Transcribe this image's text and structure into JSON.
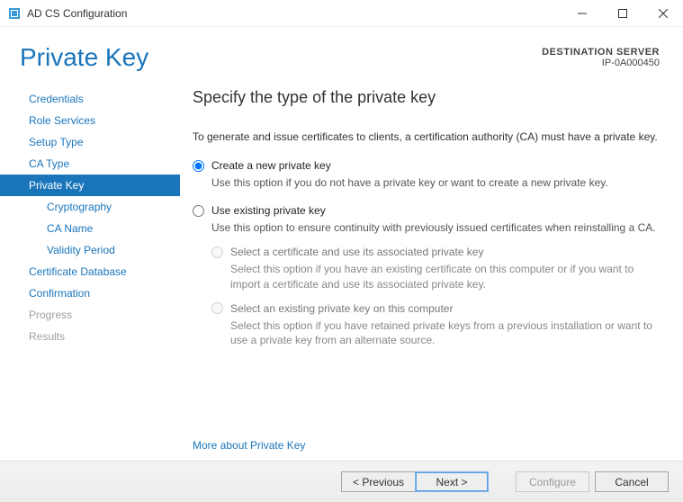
{
  "window": {
    "title": "AD CS Configuration"
  },
  "header": {
    "page_title": "Private Key",
    "destination_label": "DESTINATION SERVER",
    "destination_value": "IP-0A000450"
  },
  "sidebar": {
    "steps": [
      {
        "label": "Credentials",
        "selected": false,
        "child": false,
        "disabled": false
      },
      {
        "label": "Role Services",
        "selected": false,
        "child": false,
        "disabled": false
      },
      {
        "label": "Setup Type",
        "selected": false,
        "child": false,
        "disabled": false
      },
      {
        "label": "CA Type",
        "selected": false,
        "child": false,
        "disabled": false
      },
      {
        "label": "Private Key",
        "selected": true,
        "child": false,
        "disabled": false
      },
      {
        "label": "Cryptography",
        "selected": false,
        "child": true,
        "disabled": false
      },
      {
        "label": "CA Name",
        "selected": false,
        "child": true,
        "disabled": false
      },
      {
        "label": "Validity Period",
        "selected": false,
        "child": true,
        "disabled": false
      },
      {
        "label": "Certificate Database",
        "selected": false,
        "child": false,
        "disabled": false
      },
      {
        "label": "Confirmation",
        "selected": false,
        "child": false,
        "disabled": false
      },
      {
        "label": "Progress",
        "selected": false,
        "child": false,
        "disabled": true
      },
      {
        "label": "Results",
        "selected": false,
        "child": false,
        "disabled": true
      }
    ]
  },
  "main": {
    "heading": "Specify the type of the private key",
    "intro": "To generate and issue certificates to clients, a certification authority (CA) must have a private key.",
    "options": {
      "create": {
        "label": "Create a new private key",
        "desc": "Use this option if you do not have a private key or want to create a new private key.",
        "checked": true
      },
      "existing": {
        "label": "Use existing private key",
        "desc": "Use this option to ensure continuity with previously issued certificates when reinstalling a CA.",
        "checked": false,
        "sub": {
          "select_cert": {
            "label": "Select a certificate and use its associated private key",
            "desc": "Select this option if you have an existing certificate on this computer or if you want to import a certificate and use its associated private key."
          },
          "select_key": {
            "label": "Select an existing private key on this computer",
            "desc": "Select this option if you have retained private keys from a previous installation or want to use a private key from an alternate source."
          }
        }
      }
    },
    "more_link": "More about Private Key"
  },
  "footer": {
    "previous": "< Previous",
    "next": "Next >",
    "configure": "Configure",
    "cancel": "Cancel"
  }
}
